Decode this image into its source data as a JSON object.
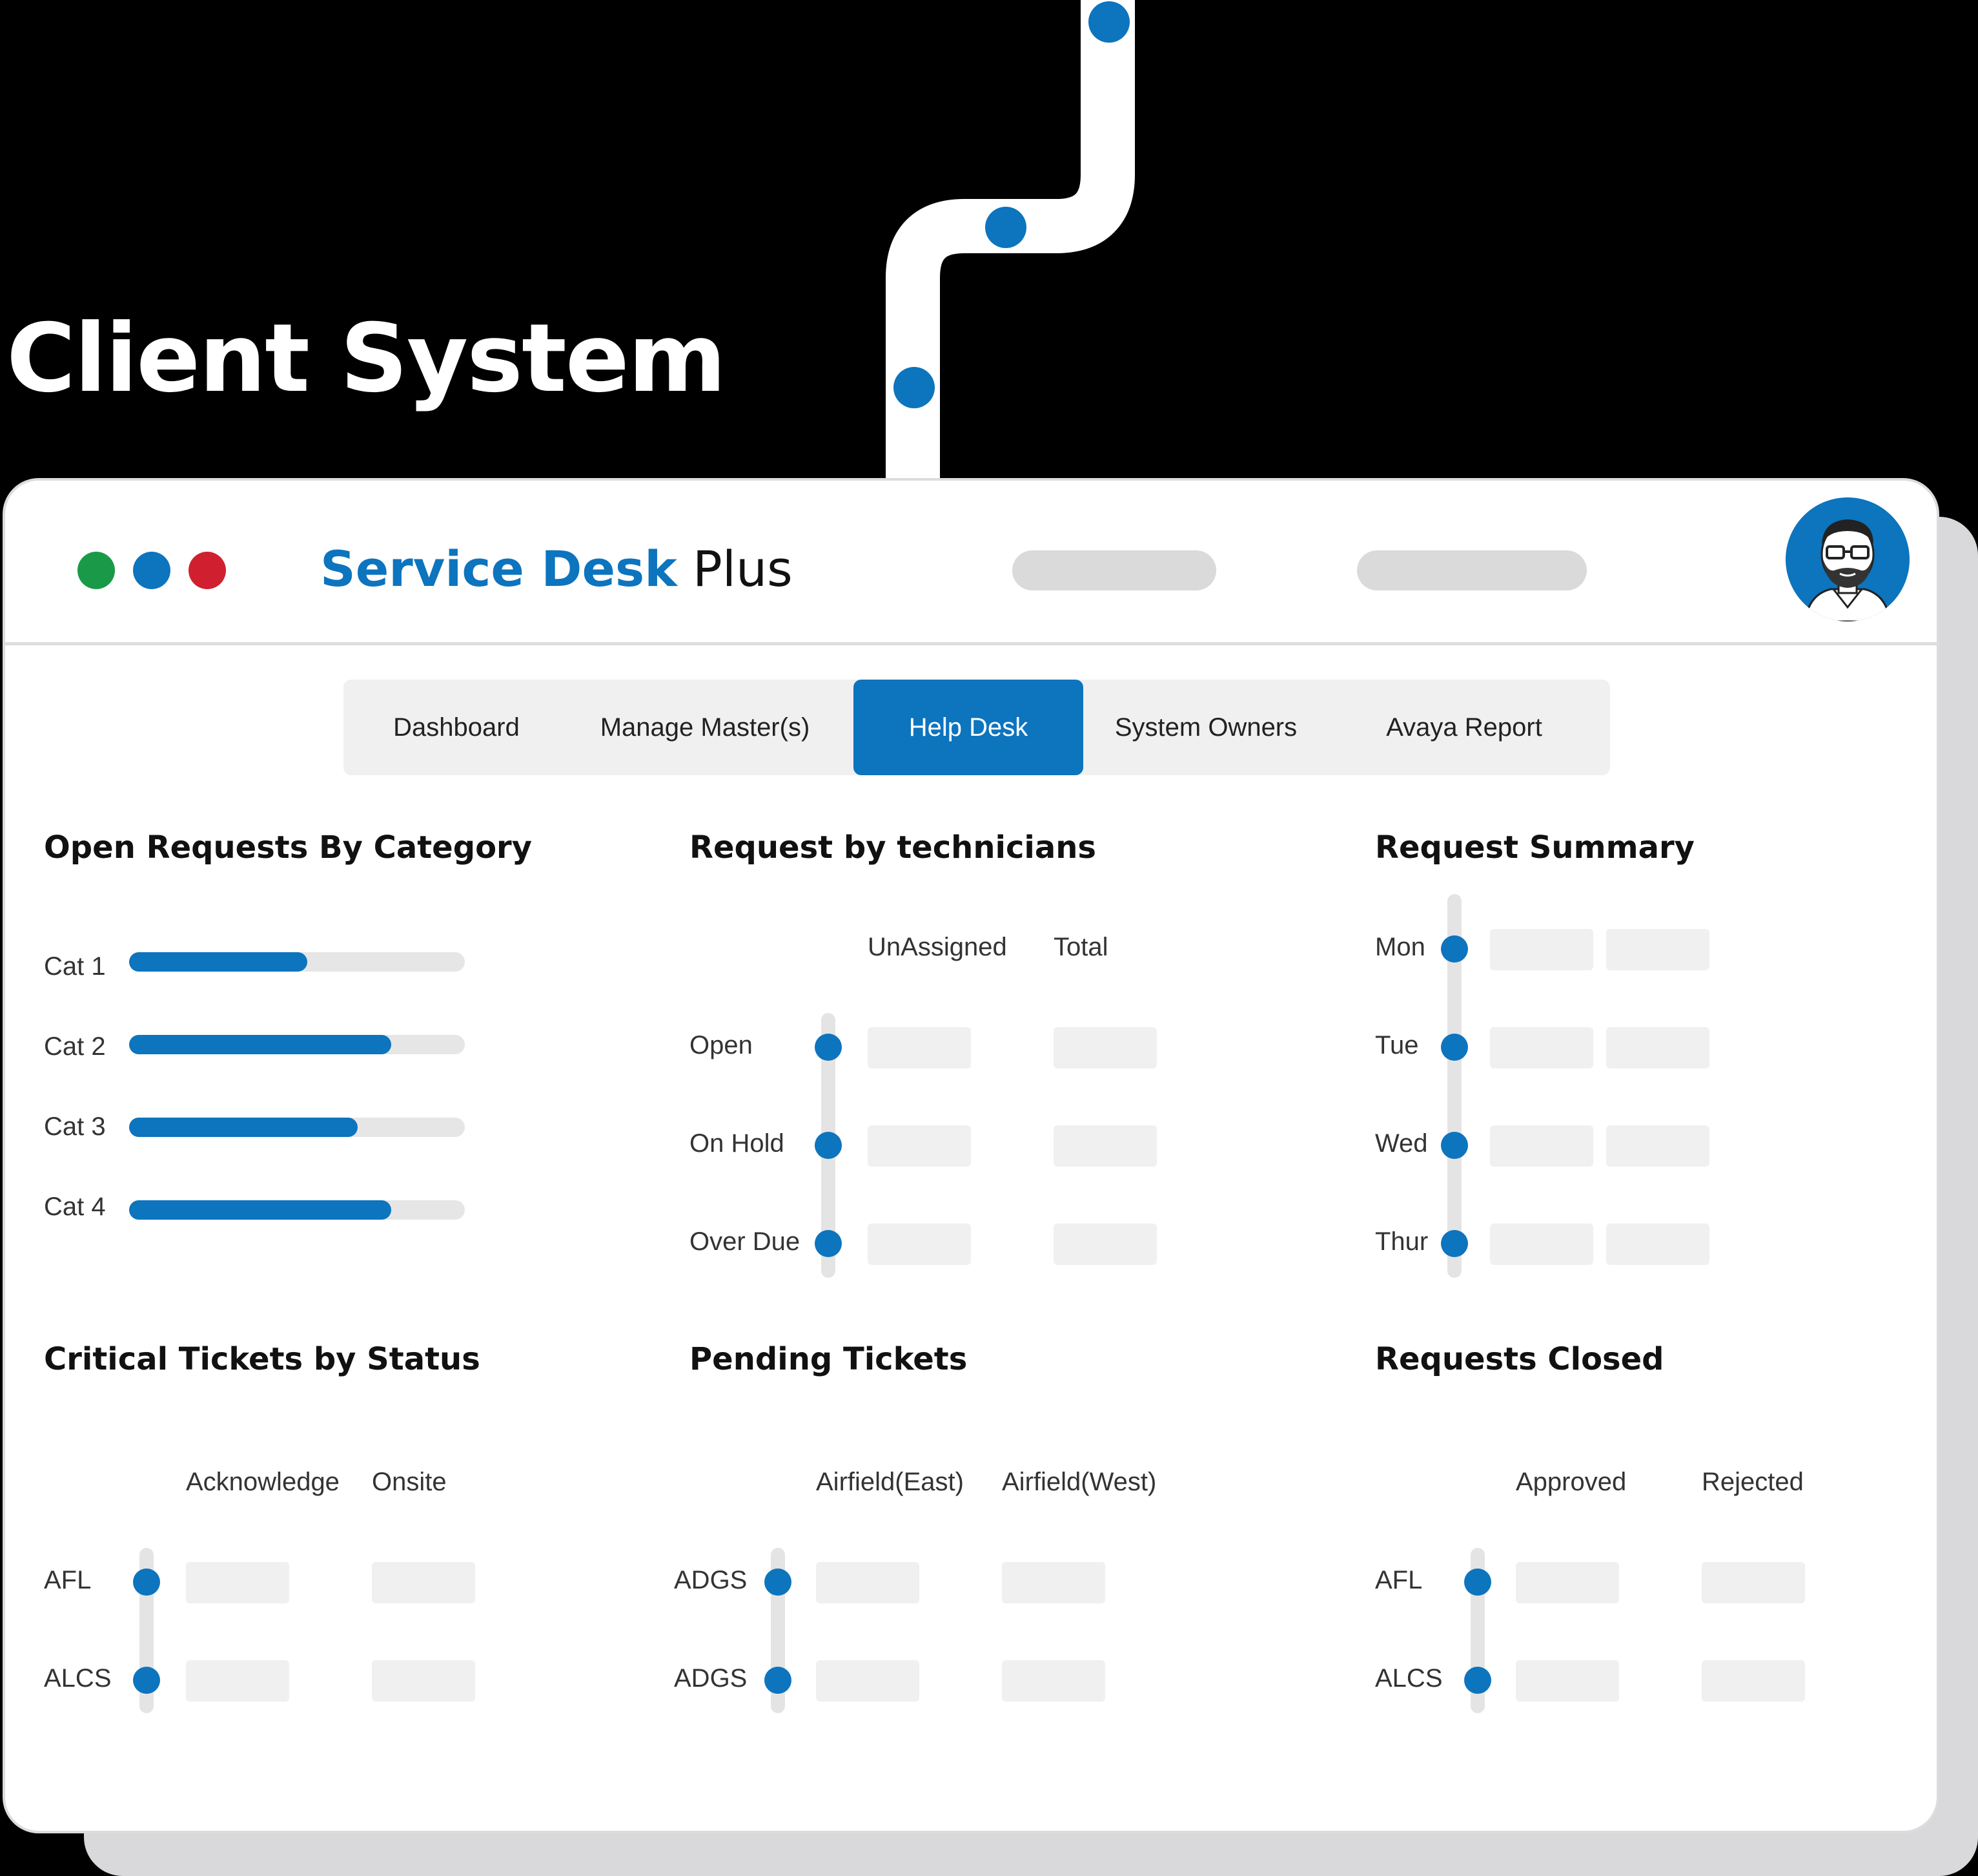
{
  "page": {
    "heading": "Client System",
    "colors": {
      "accent": "#0d74be",
      "green": "#1a9a48",
      "red": "#d0202f",
      "background": "#000000",
      "panel": "#ffffff"
    }
  },
  "app": {
    "brand_primary": "Service Desk",
    "brand_secondary": "Plus",
    "avatar_icon": "bearded-user-avatar-icon"
  },
  "nav": {
    "tabs": [
      {
        "label": "Dashboard",
        "active": false
      },
      {
        "label": "Manage Master(s)",
        "active": false
      },
      {
        "label": "Help Desk",
        "active": true
      },
      {
        "label": "System Owners",
        "active": false
      },
      {
        "label": "Avaya Report",
        "active": false
      }
    ]
  },
  "open_requests": {
    "title": "Open Requests By Category",
    "items": [
      {
        "label": "Cat 1",
        "fill": 0.53
      },
      {
        "label": "Cat 2",
        "fill": 0.78
      },
      {
        "label": "Cat 3",
        "fill": 0.68
      },
      {
        "label": "Cat 4",
        "fill": 0.78
      }
    ]
  },
  "technicians": {
    "title": "Request by technicians",
    "columns": [
      "UnAssigned",
      "Total"
    ],
    "rows": [
      "Open",
      "On Hold",
      "Over Due"
    ]
  },
  "summary": {
    "title": "Request Summary",
    "rows": [
      "Mon",
      "Tue",
      "Wed",
      "Thur"
    ]
  },
  "critical": {
    "title": "Critical Tickets by Status",
    "columns": [
      "Acknowledge",
      "Onsite"
    ],
    "rows": [
      "AFL",
      "ALCS"
    ]
  },
  "pending": {
    "title": "Pending Tickets",
    "columns": [
      "Airfield(East)",
      "Airfield(West)"
    ],
    "rows": [
      "ADGS",
      "ADGS"
    ]
  },
  "closed": {
    "title": "Requests Closed",
    "columns": [
      "Approved",
      "Rejected"
    ],
    "rows": [
      "AFL",
      "ALCS"
    ]
  }
}
